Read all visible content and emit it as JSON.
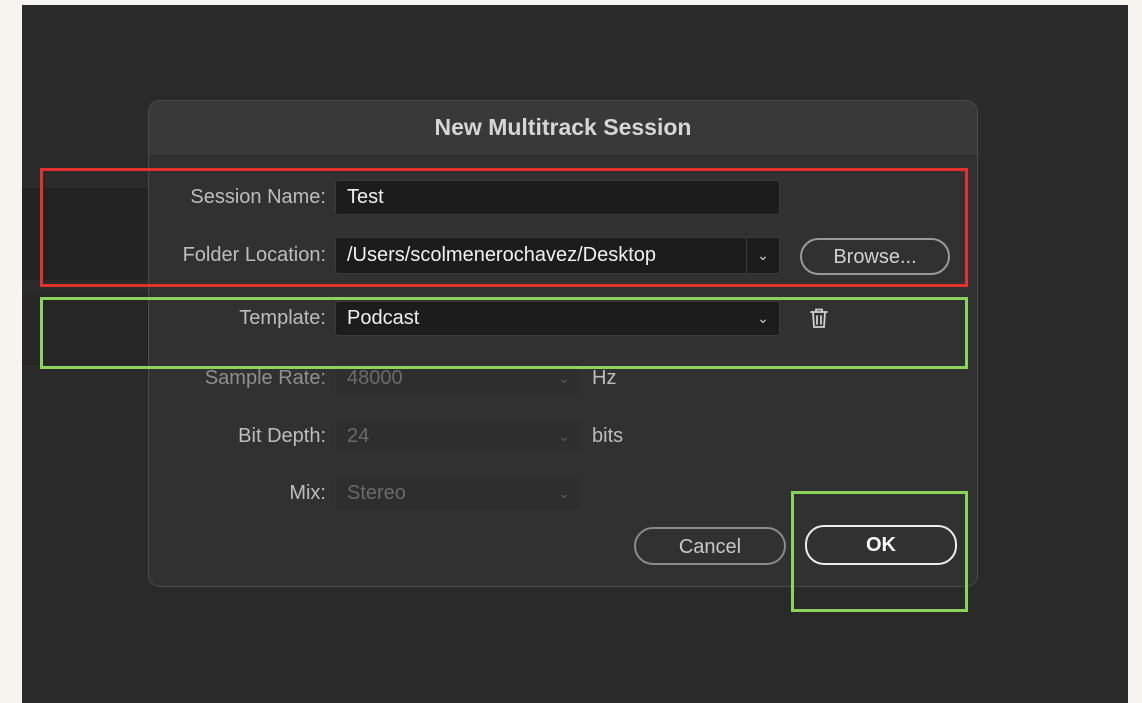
{
  "dialog": {
    "title": "New Multitrack Session",
    "session_name": {
      "label": "Session Name:",
      "value": "Test"
    },
    "folder_location": {
      "label": "Folder Location:",
      "value": "/Users/scolmenerochavez/Desktop",
      "browse_label": "Browse..."
    },
    "template": {
      "label": "Template:",
      "value": "Podcast"
    },
    "sample_rate": {
      "label": "Sample Rate:",
      "value": "48000",
      "unit": "Hz"
    },
    "bit_depth": {
      "label": "Bit Depth:",
      "value": "24",
      "unit": "bits"
    },
    "mix": {
      "label": "Mix:",
      "value": "Stereo"
    },
    "buttons": {
      "cancel": "Cancel",
      "ok": "OK"
    }
  },
  "icons": {
    "dropdown": "chevron-down-icon",
    "delete": "trash-icon"
  },
  "colors": {
    "highlight_red": "#e3322e",
    "highlight_green": "#8bd35a",
    "dialog_bg": "#313131",
    "field_bg": "#1c1c1c"
  }
}
